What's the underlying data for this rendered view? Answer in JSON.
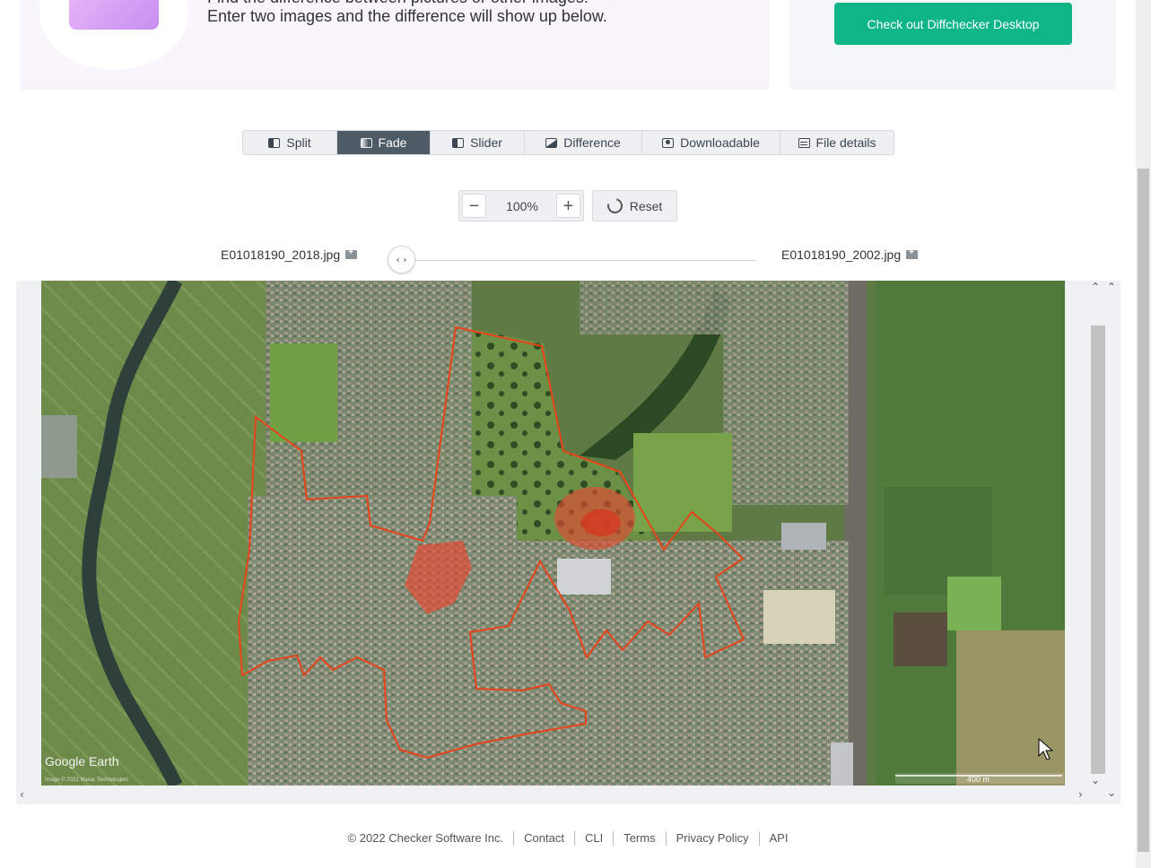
{
  "banner": {
    "line1": "Find the difference between pictures or other images!",
    "line2": "Enter two images and the difference will show up below.",
    "promo_button": "Check out Diffchecker Desktop"
  },
  "tabs": [
    {
      "label": "Split",
      "icon": "split-view-icon",
      "active": false
    },
    {
      "label": "Fade",
      "icon": "fade-view-icon",
      "active": true
    },
    {
      "label": "Slider",
      "icon": "slider-view-icon",
      "active": false
    },
    {
      "label": "Difference",
      "icon": "difference-view-icon",
      "active": false
    },
    {
      "label": "Downloadable",
      "icon": "camera-icon",
      "active": false
    },
    {
      "label": "File details",
      "icon": "file-details-icon",
      "active": false
    }
  ],
  "zoom": {
    "minus": "−",
    "level": "100%",
    "plus": "+",
    "reset_label": "Reset"
  },
  "files": {
    "left_name": "E01018190_2018.jpg",
    "right_name": "E01018190_2002.jpg",
    "fade_handle_glyph": "‹ ›"
  },
  "map": {
    "watermark": "Google Earth",
    "imagery_credit": "Image © 2022 Maxar Technologies",
    "scale_label": "400 m"
  },
  "footer": {
    "copyright": "© 2022 Checker Software Inc.",
    "links": [
      "Contact",
      "CLI",
      "Terms",
      "Privacy Policy",
      "API"
    ]
  },
  "colors": {
    "accent_green": "#0fb586",
    "active_tab": "#4e5a66",
    "boundary_red": "#e8441a"
  }
}
